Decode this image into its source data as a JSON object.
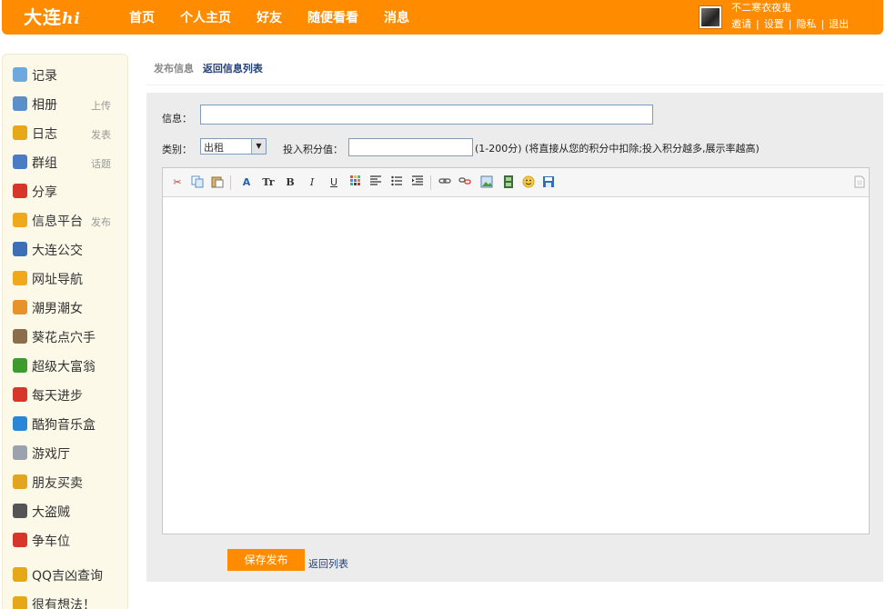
{
  "header": {
    "logo": "大连",
    "logo_suffix": "hi",
    "nav": [
      "首页",
      "个人主页",
      "好友",
      "随便看看",
      "消息"
    ],
    "user_name": "不二寒衣夜鬼",
    "user_links": [
      "邀请",
      "设置",
      "隐私",
      "退出"
    ]
  },
  "sidebar": {
    "items": [
      {
        "label": "记录",
        "action": "",
        "icon": "speech-bubble-icon",
        "color": "#6fa8dc"
      },
      {
        "label": "相册",
        "action": "上传",
        "icon": "photo-icon",
        "color": "#5b8fc9"
      },
      {
        "label": "日志",
        "action": "发表",
        "icon": "notebook-icon",
        "color": "#e6a817"
      },
      {
        "label": "群组",
        "action": "话题",
        "icon": "group-icon",
        "color": "#4a7cc4"
      },
      {
        "label": "分享",
        "action": "",
        "icon": "heart-share-icon",
        "color": "#d9362b"
      },
      {
        "label": "信息平台",
        "action": "发布",
        "icon": "question-icon",
        "color": "#f0a81c"
      },
      {
        "label": "大连公交",
        "action": "",
        "icon": "bus-icon",
        "color": "#3c6fb5"
      },
      {
        "label": "网址导航",
        "action": "",
        "icon": "question-icon",
        "color": "#f0a81c"
      },
      {
        "label": "潮男潮女",
        "action": "",
        "icon": "people-icon",
        "color": "#e8922c"
      },
      {
        "label": "葵花点穴手",
        "action": "",
        "icon": "kungfu-icon",
        "color": "#8a6d4a"
      },
      {
        "label": "超级大富翁",
        "action": "",
        "icon": "money-icon",
        "color": "#3b9b2f"
      },
      {
        "label": "每天进步",
        "action": "",
        "icon": "percent-icon",
        "color": "#d9362b"
      },
      {
        "label": "酷狗音乐盒",
        "action": "",
        "icon": "music-icon",
        "color": "#2a86d6"
      },
      {
        "label": "游戏厅",
        "action": "",
        "icon": "gamepad-icon",
        "color": "#9aa3ad"
      },
      {
        "label": "朋友买卖",
        "action": "",
        "icon": "coins-icon",
        "color": "#e3a520"
      },
      {
        "label": "大盗贼",
        "action": "",
        "icon": "thief-icon",
        "color": "#555555"
      },
      {
        "label": "争车位",
        "action": "",
        "icon": "parking-icon",
        "color": "#d9362b"
      },
      {
        "label": "QQ吉凶查询",
        "action": "",
        "icon": "qq-icon",
        "color": "#e6a817"
      },
      {
        "label": "很有想法！",
        "action": "",
        "icon": "smile-icon",
        "color": "#e6a817"
      }
    ]
  },
  "breadcrumb": {
    "current": "发布信息",
    "back": "返回信息列表"
  },
  "form": {
    "message_label": "信息：",
    "message_value": "",
    "category_label": "类别：",
    "category_value": "出租",
    "points_label": "投入积分值：",
    "points_value": "",
    "points_hint": "(1-200分) (将直接从您的积分中扣除;投入积分越多,展示率越高)"
  },
  "toolbar": {
    "buttons": [
      "cut-icon",
      "copy-icon",
      "paste-icon",
      "font-color-icon",
      "font-size-icon",
      "bold-icon",
      "italic-icon",
      "underline-icon",
      "color-grid-icon",
      "align-icon",
      "list-icon",
      "indent-icon",
      "link-icon",
      "unlink-icon",
      "image-icon",
      "media-icon",
      "emoticon-icon",
      "save-disk-icon"
    ],
    "bold": "B",
    "italic": "I",
    "underline": "U",
    "font_size": "Tr"
  },
  "actions": {
    "save": "保存发布",
    "back": "返回列表"
  },
  "colors": {
    "brand": "#ff8c00",
    "link": "#22407a",
    "panel": "#ececec"
  }
}
